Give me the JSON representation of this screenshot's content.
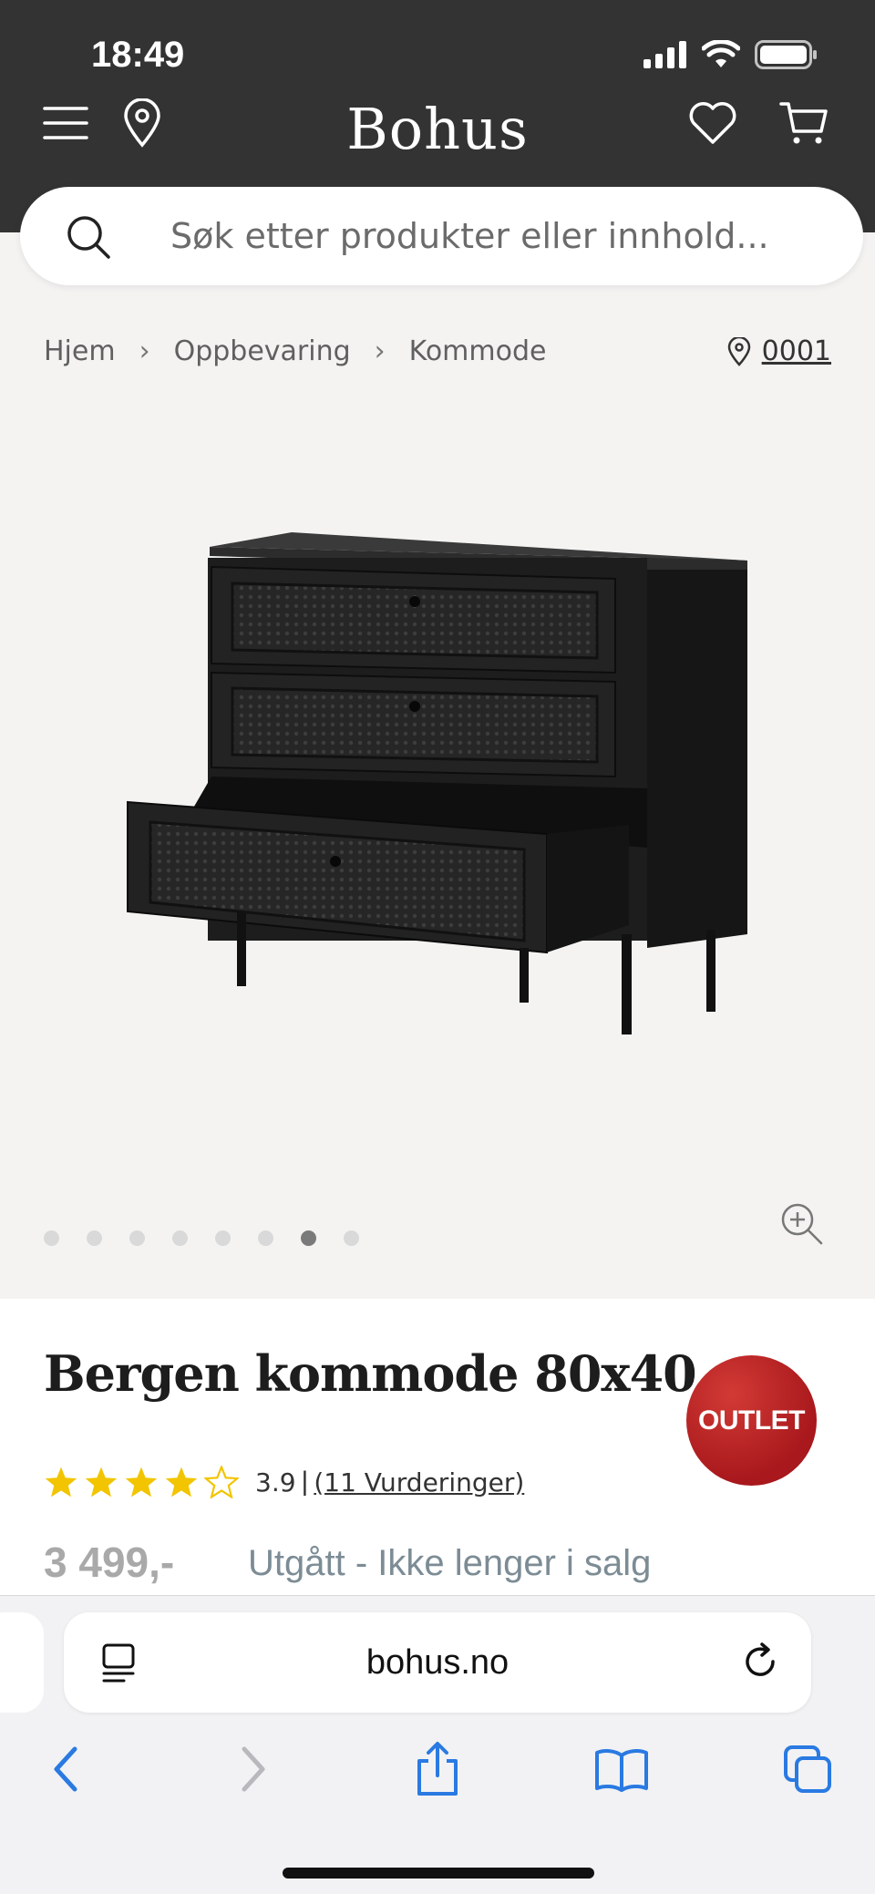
{
  "status_bar": {
    "time": "18:49"
  },
  "header": {
    "logo": "Bohus"
  },
  "search": {
    "placeholder": "Søk etter produkter eller innhold..."
  },
  "breadcrumb": {
    "items": [
      "Hjem",
      "Oppbevaring",
      "Kommode"
    ],
    "store": "0001"
  },
  "carousel": {
    "total_images": 8,
    "active_index": 6
  },
  "product": {
    "title": "Bergen kommode 80x40",
    "badge": "OUTLET",
    "rating": 3.9,
    "rating_value": "3.9",
    "rating_separator": "|",
    "rating_count": "(11 Vurderinger)",
    "price": "3 499,-",
    "availability": "Utgått - Ikke lenger i salg"
  },
  "browser": {
    "url": "bohus.no"
  },
  "colors": {
    "header_bg": "#333334",
    "page_bg": "#f4f3f2",
    "outlet_red": "#b8201f",
    "star_yellow": "#f2c500",
    "link_blue": "#1a73e8"
  }
}
